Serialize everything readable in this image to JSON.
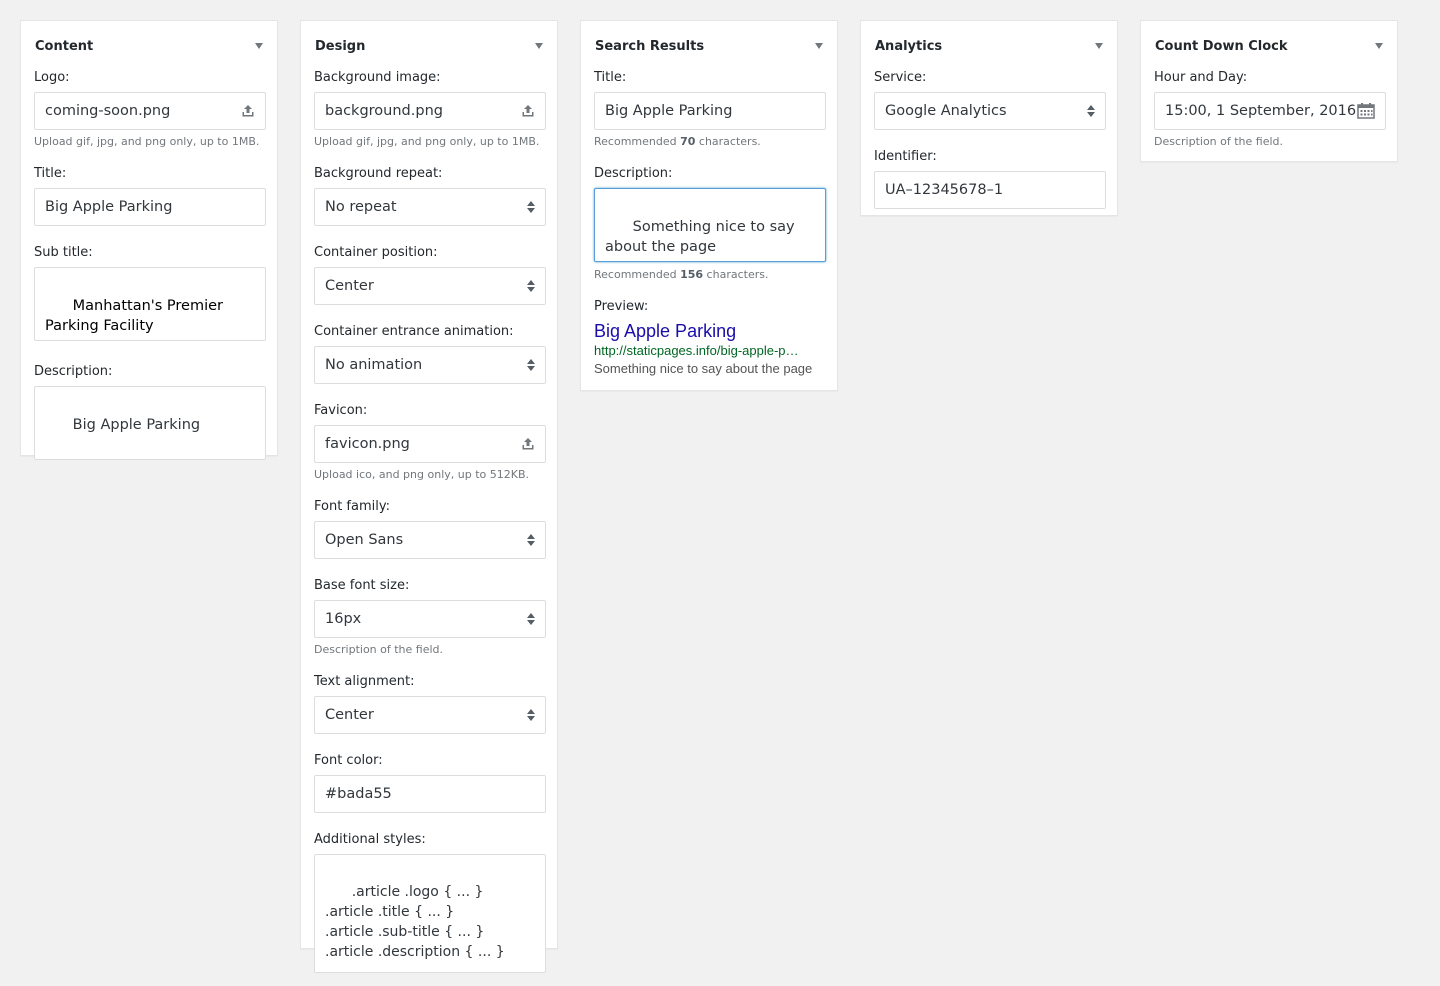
{
  "colors": {
    "background": "#f1f1f1",
    "panel": "#ffffff",
    "focus_border": "#5b9dd9",
    "preview_title": "#1a0dab",
    "preview_url": "#006621"
  },
  "content": {
    "title": "Content",
    "logo_label": "Logo:",
    "logo_value": "coming-soon.png",
    "logo_help": "Upload gif, jpg, and png only, up to 1MB.",
    "title_label": "Title:",
    "title_value": "Big Apple Parking",
    "subtitle_label": "Sub title:",
    "subtitle_value": "Manhattan's Premier Parking Facility",
    "description_label": "Description:",
    "description_value": "Big Apple Parking"
  },
  "design": {
    "title": "Design",
    "bg_image_label": "Background image:",
    "bg_image_value": "background.png",
    "bg_image_help": "Upload gif, jpg, and png only, up to 1MB.",
    "bg_repeat_label": "Background repeat:",
    "bg_repeat_value": "No repeat",
    "container_position_label": "Container position:",
    "container_position_value": "Center",
    "container_animation_label": "Container entrance animation:",
    "container_animation_value": "No animation",
    "favicon_label": "Favicon:",
    "favicon_value": "favicon.png",
    "favicon_help": "Upload ico, and png only, up to 512KB.",
    "font_family_label": "Font family:",
    "font_family_value": "Open Sans",
    "base_font_size_label": "Base font size:",
    "base_font_size_value": "16px",
    "base_font_size_help": "Description of the field.",
    "text_alignment_label": "Text alignment:",
    "text_alignment_value": "Center",
    "font_color_label": "Font color:",
    "font_color_value": "#bada55",
    "additional_styles_label": "Additional styles:",
    "additional_styles_value": ".article .logo { ... }\n.article .title { ... }\n.article .sub-title { ... }\n.article .description { ... }\n..."
  },
  "search_results": {
    "title": "Search Results",
    "title_label": "Title:",
    "title_value": "Big Apple Parking",
    "title_help_prefix": "Recommended ",
    "title_help_count": "70",
    "title_help_suffix": " characters.",
    "description_label": "Description:",
    "description_value": "Something nice to say about the page",
    "description_help_prefix": "Recommended ",
    "description_help_count": "156",
    "description_help_suffix": " characters.",
    "preview_label": "Preview:",
    "preview_title": "Big Apple Parking",
    "preview_url": "http://staticpages.info/big-apple-p…",
    "preview_desc": "Something nice to say about the page"
  },
  "analytics": {
    "title": "Analytics",
    "service_label": "Service:",
    "service_value": "Google Analytics",
    "identifier_label": "Identifier:",
    "identifier_value": "UA–12345678–1"
  },
  "countdown": {
    "title": "Count Down Clock",
    "hour_day_label": "Hour and Day:",
    "hour_day_value": "15:00, 1 September, 2016.",
    "hour_day_help": "Description of the field."
  }
}
